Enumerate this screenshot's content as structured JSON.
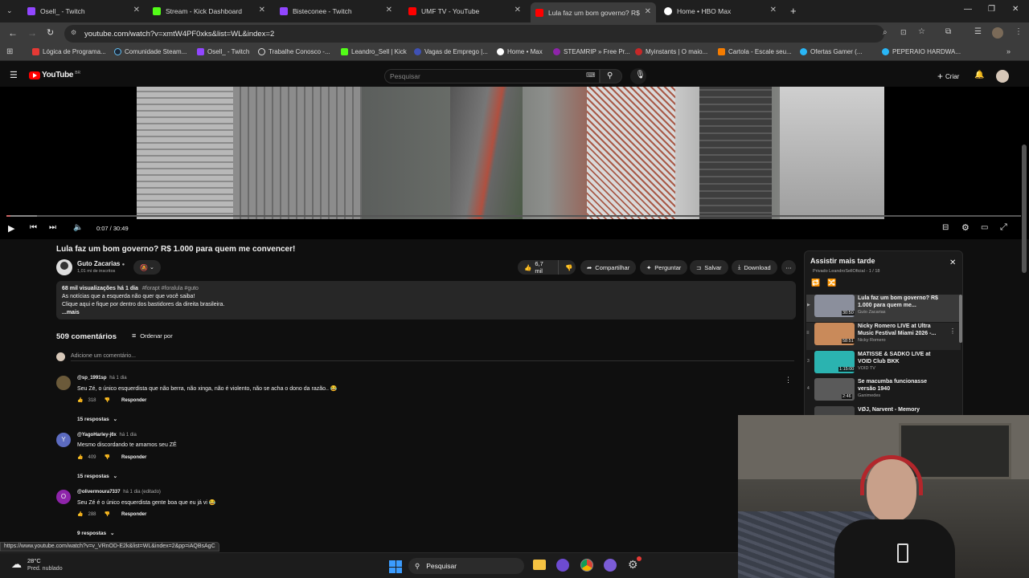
{
  "tabs": [
    {
      "label": "Osell_ - Twitch",
      "color": "#9146ff"
    },
    {
      "label": "Stream - Kick Dashboard",
      "color": "#53fc18"
    },
    {
      "label": "Bisteconee - Twitch",
      "color": "#9146ff"
    },
    {
      "label": "UMF TV - YouTube",
      "color": "#ff0000"
    },
    {
      "label": "Lula faz um bom governo? R$",
      "color": "#ff0000"
    },
    {
      "label": "Home • HBO Max",
      "color": "#ffffff"
    }
  ],
  "address": {
    "url": "youtube.com/watch?v=xmtW4PF0xks&list=WL&index=2"
  },
  "bookmarks": [
    "Lógica de Programa...",
    "Comunidade Steam...",
    "Osell_ - Twitch",
    "Trabalhe Conosco -...",
    "Leandro_Sell | Kick",
    "Vagas de Emprego |...",
    "Home • Max",
    "STEAMRIP » Free Pr...",
    "Myinstants | O maio...",
    "Cartola - Escale seu...",
    "Ofertas Gamer (...",
    "PEPERAIO HARDWA..."
  ],
  "youtube": {
    "logo": "YouTube",
    "region": "BR",
    "search_placeholder": "Pesquisar",
    "create_label": "Criar"
  },
  "player": {
    "time": "0:07 / 30:49",
    "progress": 0.0038
  },
  "video": {
    "title": "Lula faz um bom governo? R$ 1.000 para quem me convencer!",
    "channel": "Guto Zacarias",
    "subscribers": "1,01 mi de inscritos",
    "likes": "6,7 mil",
    "share": "Compartilhar",
    "ask": "Perguntar",
    "save": "Salvar",
    "download": "Download",
    "description": {
      "meta": "68 mil visualizações  há 1 dia",
      "tags": "#forapt #foralula #guto",
      "line1": "As notícias que a esquerda não quer que você saiba!",
      "line2": "Clique aqui e fique por dentro  dos bastidores da direita brasileira.",
      "more": "...mais"
    }
  },
  "comments_section": {
    "count": "509 comentários",
    "sort": "Ordenar por",
    "add_placeholder": "Adicione um comentário...",
    "reply": "Responder",
    "items": [
      {
        "user": "@sp_1991sp",
        "when": "há 1 dia",
        "text": "Seu Zé, o único esquerdista que não berra, não xinga, não é violento, não se acha o dono da razão.. 😂",
        "likes": "318",
        "replies": "15 respostas",
        "avatar_letter": "",
        "avatar_color": "#6b5a3a"
      },
      {
        "user": "@YagoHarley-j6x",
        "when": "há 1 dia",
        "text": "Mesmo discordando te amamos seu ZÉ",
        "likes": "409",
        "replies": "15 respostas",
        "avatar_letter": "Y",
        "avatar_color": "#5c6bc0"
      },
      {
        "user": "@olivermoura7337",
        "when": "há 1 dia (editado)",
        "text": "Seu Zé é o único esquerdista gente boa que eu já vi 😂",
        "likes": "288",
        "replies": "9 respostas",
        "avatar_letter": "O",
        "avatar_color": "#8e24aa"
      }
    ]
  },
  "playlist": {
    "title": "Assistir mais tarde",
    "subtitle": "Privado LeandroSellOficial - 1 / 18",
    "items": [
      {
        "index": "▶",
        "title": "Lula faz um bom governo? R$ 1.000 para quem me...",
        "channel": "Guto Zacarias",
        "duration": "30:50",
        "color": "#8b8f9c"
      },
      {
        "index": "2",
        "title": "Nicky Romero LIVE at Ultra Music Festival Miami 2026 -...",
        "channel": "Nicky Romero",
        "duration": "58:51",
        "color": "#c98a5a"
      },
      {
        "index": "3",
        "title": "MATISSE & SADKO LIVE at VOID Club BKK",
        "channel": "VOID TV",
        "duration": "1:15:00",
        "color": "#2bb3b0"
      },
      {
        "index": "4",
        "title": "Se macumba funcionasse versão 1940",
        "channel": "Ganimedes",
        "duration": "2:46",
        "color": "#5a5a5a"
      },
      {
        "index": "5",
        "title": "VØJ, Narvent - Memory",
        "channel": "",
        "duration": "",
        "color": "#444"
      }
    ]
  },
  "statusbar": {
    "url": "https://www.youtube.com/watch?v=v_VRnOD-E2k&list=WL&index=2&pp=iAQBsAgC"
  },
  "taskbar": {
    "temp": "28°C",
    "weather": "Pred. nublado",
    "search": "Pesquisar"
  }
}
